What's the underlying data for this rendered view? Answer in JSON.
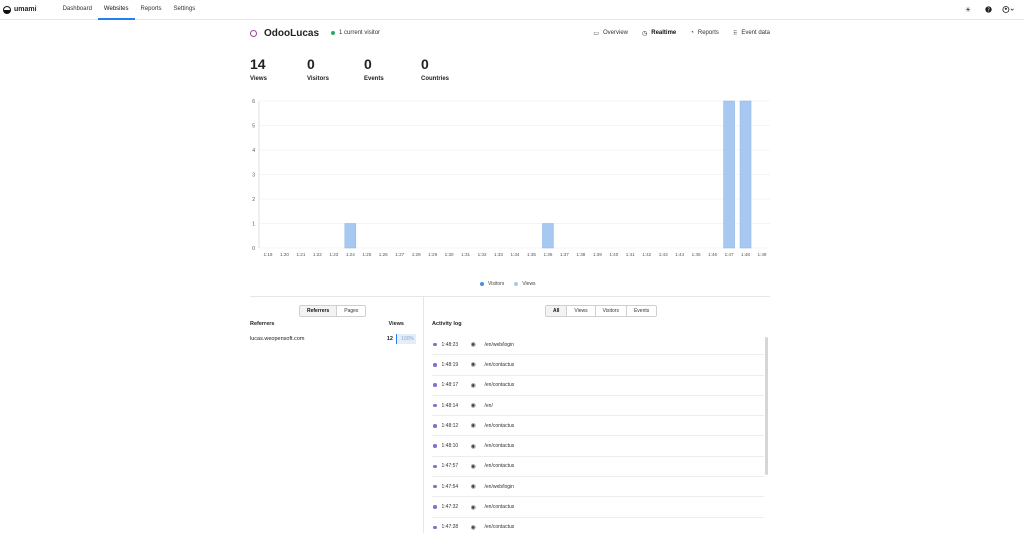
{
  "app": {
    "name": "umami"
  },
  "nav": {
    "items": [
      "Dashboard",
      "Websites",
      "Reports",
      "Settings"
    ],
    "active": "Websites"
  },
  "website": {
    "name": "OdooLucas",
    "current_visitors": "1 current visitor"
  },
  "site_tabs": [
    "Overview",
    "Realtime",
    "Reports",
    "Event data"
  ],
  "metrics": [
    {
      "label": "Views",
      "value": "14"
    },
    {
      "label": "Visitors",
      "value": "0"
    },
    {
      "label": "Events",
      "value": "0"
    },
    {
      "label": "Countries",
      "value": "0"
    }
  ],
  "chart_data": {
    "type": "bar",
    "categories": [
      "1:19",
      "1:20",
      "1:21",
      "1:22",
      "1:23",
      "1:24",
      "1:25",
      "1:26",
      "1:27",
      "1:28",
      "1:29",
      "1:30",
      "1:31",
      "1:32",
      "1:33",
      "1:34",
      "1:35",
      "1:36",
      "1:37",
      "1:38",
      "1:39",
      "1:40",
      "1:41",
      "1:42",
      "1:43",
      "1:44",
      "1:45",
      "1:46",
      "1:47",
      "1:48",
      "1:49"
    ],
    "series": [
      {
        "name": "Visitors",
        "values": [
          0,
          0,
          0,
          0,
          0,
          0,
          0,
          0,
          0,
          0,
          0,
          0,
          0,
          0,
          0,
          0,
          0,
          0,
          0,
          0,
          0,
          0,
          0,
          0,
          0,
          0,
          0,
          0,
          0,
          0,
          0
        ]
      },
      {
        "name": "Views",
        "values": [
          0,
          0,
          0,
          0,
          0,
          1,
          0,
          0,
          0,
          0,
          0,
          0,
          0,
          0,
          0,
          0,
          0,
          1,
          0,
          0,
          0,
          0,
          0,
          0,
          0,
          0,
          0,
          0,
          6,
          6,
          0
        ]
      }
    ],
    "ylim": [
      0,
      6
    ],
    "yticks": [
      "0",
      "1",
      "2",
      "3",
      "4",
      "5",
      "6"
    ],
    "grid": true,
    "legend": "bottom",
    "colors": {
      "Visitors": "#4a90d9",
      "Views": "#a7c8f0"
    }
  },
  "left_panel": {
    "tabs": [
      "Referrers",
      "Pages"
    ],
    "header_name": "Referrers",
    "header_views": "Views",
    "rows": [
      {
        "name": "lucas.weopensoft.com",
        "views": "12",
        "percent": "100%"
      }
    ]
  },
  "activity": {
    "filters": [
      "All",
      "Views",
      "Visitors",
      "Events"
    ],
    "title": "Activity log",
    "rows": [
      {
        "time": "1:48:23",
        "path": "/en/web/login"
      },
      {
        "time": "1:48:19",
        "path": "/en/contactus"
      },
      {
        "time": "1:48:17",
        "path": "/en/contactus"
      },
      {
        "time": "1:48:14",
        "path": "/en/"
      },
      {
        "time": "1:48:12",
        "path": "/en/contactus"
      },
      {
        "time": "1:48:10",
        "path": "/en/contactus"
      },
      {
        "time": "1:47:57",
        "path": "/en/contactus"
      },
      {
        "time": "1:47:54",
        "path": "/en/web/login"
      },
      {
        "time": "1:47:32",
        "path": "/en/contactus"
      },
      {
        "time": "1:47:28",
        "path": "/en/contactus"
      }
    ]
  }
}
